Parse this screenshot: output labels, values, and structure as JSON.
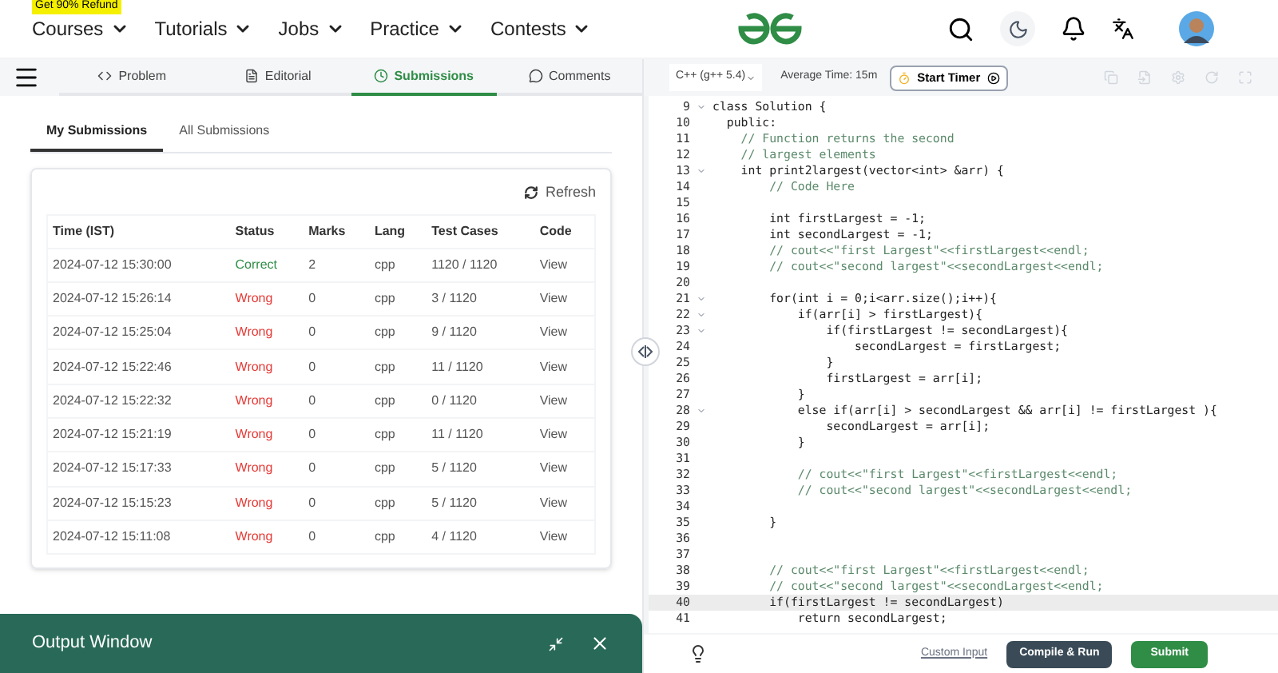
{
  "nav": {
    "promo": "Get 90% Refund",
    "menus": [
      {
        "label": "Courses"
      },
      {
        "label": "Tutorials"
      },
      {
        "label": "Jobs"
      },
      {
        "label": "Practice"
      },
      {
        "label": "Contests"
      }
    ]
  },
  "problem_tabs": [
    {
      "label": "Problem",
      "selected": false
    },
    {
      "label": "Editorial",
      "selected": false
    },
    {
      "label": "Submissions",
      "selected": true
    },
    {
      "label": "Comments",
      "selected": false
    }
  ],
  "submission_tabs": [
    {
      "label": "My Submissions",
      "selected": true
    },
    {
      "label": "All Submissions",
      "selected": false
    }
  ],
  "refresh": "Refresh",
  "table": {
    "columns": [
      "Time (IST)",
      "Status",
      "Marks",
      "Lang",
      "Test Cases",
      "Code"
    ],
    "rows": [
      {
        "time": "2024-07-12 15:30:00",
        "status": "Correct",
        "correct": true,
        "marks": "2",
        "lang": "cpp",
        "tests": "1120 / 1120",
        "code": "View"
      },
      {
        "time": "2024-07-12 15:26:14",
        "status": "Wrong",
        "correct": false,
        "marks": "0",
        "lang": "cpp",
        "tests": "3 / 1120",
        "code": "View"
      },
      {
        "time": "2024-07-12 15:25:04",
        "status": "Wrong",
        "correct": false,
        "marks": "0",
        "lang": "cpp",
        "tests": "9 / 1120",
        "code": "View"
      },
      {
        "time": "2024-07-12 15:22:46",
        "status": "Wrong",
        "correct": false,
        "marks": "0",
        "lang": "cpp",
        "tests": "11 / 1120",
        "code": "View"
      },
      {
        "time": "2024-07-12 15:22:32",
        "status": "Wrong",
        "correct": false,
        "marks": "0",
        "lang": "cpp",
        "tests": "0 / 1120",
        "code": "View"
      },
      {
        "time": "2024-07-12 15:21:19",
        "status": "Wrong",
        "correct": false,
        "marks": "0",
        "lang": "cpp",
        "tests": "11 / 1120",
        "code": "View"
      },
      {
        "time": "2024-07-12 15:17:33",
        "status": "Wrong",
        "correct": false,
        "marks": "0",
        "lang": "cpp",
        "tests": "5 / 1120",
        "code": "View"
      },
      {
        "time": "2024-07-12 15:15:23",
        "status": "Wrong",
        "correct": false,
        "marks": "0",
        "lang": "cpp",
        "tests": "5 / 1120",
        "code": "View"
      },
      {
        "time": "2024-07-12 15:11:08",
        "status": "Wrong",
        "correct": false,
        "marks": "0",
        "lang": "cpp",
        "tests": "4 / 1120",
        "code": "View"
      }
    ]
  },
  "output_window": {
    "title": "Output Window"
  },
  "editor_bar": {
    "language": "C++ (g++ 5.4)",
    "average_time": "Average Time: 15m",
    "timer_button": "Start Timer"
  },
  "code_lines": [
    {
      "number": "9",
      "text": "class Solution {",
      "kind": "code",
      "fold": true,
      "selected": false
    },
    {
      "number": "10",
      "text": "  public:",
      "kind": "code",
      "fold": false,
      "selected": false
    },
    {
      "number": "11",
      "text": "    // Function returns the second",
      "kind": "comment",
      "fold": false,
      "selected": false
    },
    {
      "number": "12",
      "text": "    // largest elements",
      "kind": "comment",
      "fold": false,
      "selected": false
    },
    {
      "number": "13",
      "text": "    int print2largest(vector<int> &arr) {",
      "kind": "code",
      "fold": true,
      "selected": false
    },
    {
      "number": "14",
      "text": "        // Code Here",
      "kind": "comment",
      "fold": false,
      "selected": false
    },
    {
      "number": "15",
      "kind": "code",
      "fold": false,
      "selected": false
    },
    {
      "number": "16",
      "text": "        int firstLargest = -1;",
      "kind": "code",
      "fold": false,
      "selected": false
    },
    {
      "number": "17",
      "text": "        int secondLargest = -1;",
      "kind": "code",
      "fold": false,
      "selected": false
    },
    {
      "number": "18",
      "text": "        // cout<<\"first Largest\"<<firstLargest<<endl;",
      "kind": "comment",
      "fold": false,
      "selected": false
    },
    {
      "number": "19",
      "text": "        // cout<<\"second largest\"<<secondLargest<<endl;",
      "kind": "comment",
      "fold": false,
      "selected": false
    },
    {
      "number": "20",
      "kind": "code",
      "fold": false,
      "selected": false
    },
    {
      "number": "21",
      "text": "        for(int i = 0;i<arr.size();i++){",
      "kind": "code",
      "fold": true,
      "selected": false
    },
    {
      "number": "22",
      "text": "            if(arr[i] > firstLargest){",
      "kind": "code",
      "fold": true,
      "selected": false
    },
    {
      "number": "23",
      "text": "                if(firstLargest != secondLargest){",
      "kind": "code",
      "fold": true,
      "selected": false
    },
    {
      "number": "24",
      "text": "                    secondLargest = firstLargest;",
      "kind": "code",
      "fold": false,
      "selected": false
    },
    {
      "number": "25",
      "text": "                }",
      "kind": "code",
      "fold": false,
      "selected": false
    },
    {
      "number": "26",
      "text": "                firstLargest = arr[i];",
      "kind": "code",
      "fold": false,
      "selected": false
    },
    {
      "number": "27",
      "text": "            }",
      "kind": "code",
      "fold": false,
      "selected": false
    },
    {
      "number": "28",
      "text": "            else if(arr[i] > secondLargest && arr[i] != firstLargest ){",
      "kind": "code",
      "fold": true,
      "selected": false
    },
    {
      "number": "29",
      "text": "                secondLargest = arr[i];",
      "kind": "code",
      "fold": false,
      "selected": false
    },
    {
      "number": "30",
      "text": "            }",
      "kind": "code",
      "fold": false,
      "selected": false
    },
    {
      "number": "31",
      "kind": "code",
      "fold": false,
      "selected": false
    },
    {
      "number": "32",
      "text": "            // cout<<\"first Largest\"<<firstLargest<<endl;",
      "kind": "comment",
      "fold": false,
      "selected": false
    },
    {
      "number": "33",
      "text": "            // cout<<\"second largest\"<<secondLargest<<endl;",
      "kind": "comment",
      "fold": false,
      "selected": false
    },
    {
      "number": "34",
      "kind": "code",
      "fold": false,
      "selected": false
    },
    {
      "number": "35",
      "text": "        }",
      "kind": "code",
      "fold": false,
      "selected": false
    },
    {
      "number": "36",
      "kind": "code",
      "fold": false,
      "selected": false
    },
    {
      "number": "37",
      "kind": "code",
      "fold": false,
      "selected": false
    },
    {
      "number": "38",
      "text": "        // cout<<\"first Largest\"<<firstLargest<<endl;",
      "kind": "comment",
      "fold": false,
      "selected": false
    },
    {
      "number": "39",
      "text": "        // cout<<\"second largest\"<<secondLargest<<endl;",
      "kind": "comment",
      "fold": false,
      "selected": false
    },
    {
      "number": "40",
      "text": "        if(firstLargest != secondLargest)",
      "kind": "code",
      "fold": false,
      "selected": true
    },
    {
      "number": "41",
      "text": "            return secondLargest;",
      "kind": "code",
      "fold": false,
      "selected": false
    }
  ],
  "editor_footer": {
    "custom_input": "Custom Input",
    "compile_button": "Compile & Run",
    "submit_button": "Submit"
  }
}
